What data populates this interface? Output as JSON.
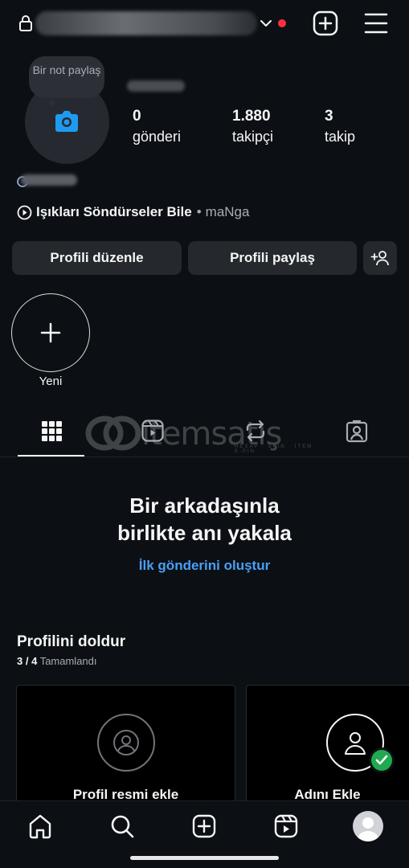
{
  "header": {
    "username": "",
    "has_notification_dot": true,
    "icons": [
      "lock-icon",
      "chevron-down-icon",
      "plus-square-icon",
      "menu-icon"
    ]
  },
  "profile": {
    "note_placeholder": "Bir not paylaş",
    "stats": [
      {
        "value": "0",
        "label": "gönderi"
      },
      {
        "value": "1.880",
        "label": "takipçi"
      },
      {
        "value": "3",
        "label": "takip"
      }
    ],
    "music": {
      "song": "Işıkları Söndürseler Bile",
      "separator": "•",
      "artist": "maNga"
    }
  },
  "actions": {
    "edit_profile": "Profili düzenle",
    "share_profile": "Profili paylaş"
  },
  "highlights": {
    "new_label": "Yeni"
  },
  "tabs": [
    "grid",
    "reels",
    "reposts",
    "tagged"
  ],
  "watermark": {
    "text": "itemsatış",
    "subtext": "HESAP · SKIN · İTEM · E-PIN"
  },
  "empty_state": {
    "title_line1": "Bir arkadaşınla",
    "title_line2": "birlikte anı yakala",
    "link": "İlk gönderini oluştur"
  },
  "complete_profile": {
    "title": "Profilini doldur",
    "progress_count": "3 / 4",
    "progress_label": "Tamamlandı",
    "cards": [
      {
        "label": "Profil resmi ekle",
        "completed": false
      },
      {
        "label": "Adını Ekle",
        "completed": true
      }
    ]
  },
  "bottom_nav": [
    "home",
    "search",
    "create",
    "reels",
    "profile"
  ],
  "colors": {
    "background": "#0c1014",
    "button_bg": "#25292e",
    "link_blue": "#4a9ff5",
    "camera_blue": "#1e9bf0",
    "notification_red": "#ff3040",
    "success_green": "#1faa4f"
  }
}
